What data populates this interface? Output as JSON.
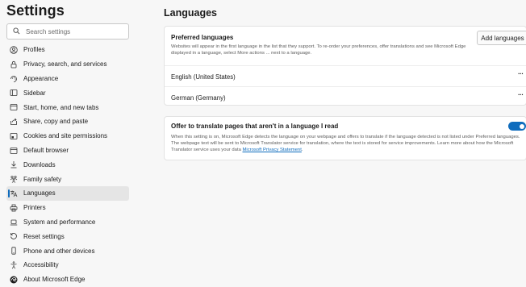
{
  "sidebar": {
    "title": "Settings",
    "search_placeholder": "Search settings",
    "items": [
      {
        "label": "Profiles",
        "icon": "profile-icon"
      },
      {
        "label": "Privacy, search, and services",
        "icon": "lock-icon"
      },
      {
        "label": "Appearance",
        "icon": "appearance-icon"
      },
      {
        "label": "Sidebar",
        "icon": "sidebar-icon"
      },
      {
        "label": "Start, home, and new tabs",
        "icon": "home-icon"
      },
      {
        "label": "Share, copy and paste",
        "icon": "share-icon"
      },
      {
        "label": "Cookies and site permissions",
        "icon": "permissions-icon"
      },
      {
        "label": "Default browser",
        "icon": "browser-icon"
      },
      {
        "label": "Downloads",
        "icon": "download-icon"
      },
      {
        "label": "Family safety",
        "icon": "family-icon"
      },
      {
        "label": "Languages",
        "icon": "language-icon",
        "active": true
      },
      {
        "label": "Printers",
        "icon": "printer-icon"
      },
      {
        "label": "System and performance",
        "icon": "laptop-icon"
      },
      {
        "label": "Reset settings",
        "icon": "reset-icon"
      },
      {
        "label": "Phone and other devices",
        "icon": "phone-icon"
      },
      {
        "label": "Accessibility",
        "icon": "accessibility-icon"
      },
      {
        "label": "About Microsoft Edge",
        "icon": "edge-logo-icon"
      }
    ]
  },
  "main": {
    "title": "Languages",
    "preferred": {
      "title": "Preferred languages",
      "description": "Websites will appear in the first language in the list that they support. To re-order your preferences, offer translations and see Microsoft Edge displayed in a language, select More actions ... next to a language.",
      "add_button": "Add languages",
      "languages": [
        "English (United States)",
        "German (Germany)"
      ],
      "more_label": "···"
    },
    "translate": {
      "title": "Offer to translate pages that aren't in a language I read",
      "description": "When this setting is on, Microsoft Edge detects the language on your webpage and offers to translate if the language detected is not listed under Preferred languages. The webpage text will be sent to Microsoft Translator service for translation, where the text is stored for service improvements. Learn more about how the Microsoft Translator service uses your data",
      "link": "Microsoft Privacy Statement",
      "link_suffix": ".",
      "toggle_on": true
    }
  },
  "colors": {
    "accent": "#0f6cbd",
    "background": "#f7f7f7",
    "card": "#ffffff"
  }
}
